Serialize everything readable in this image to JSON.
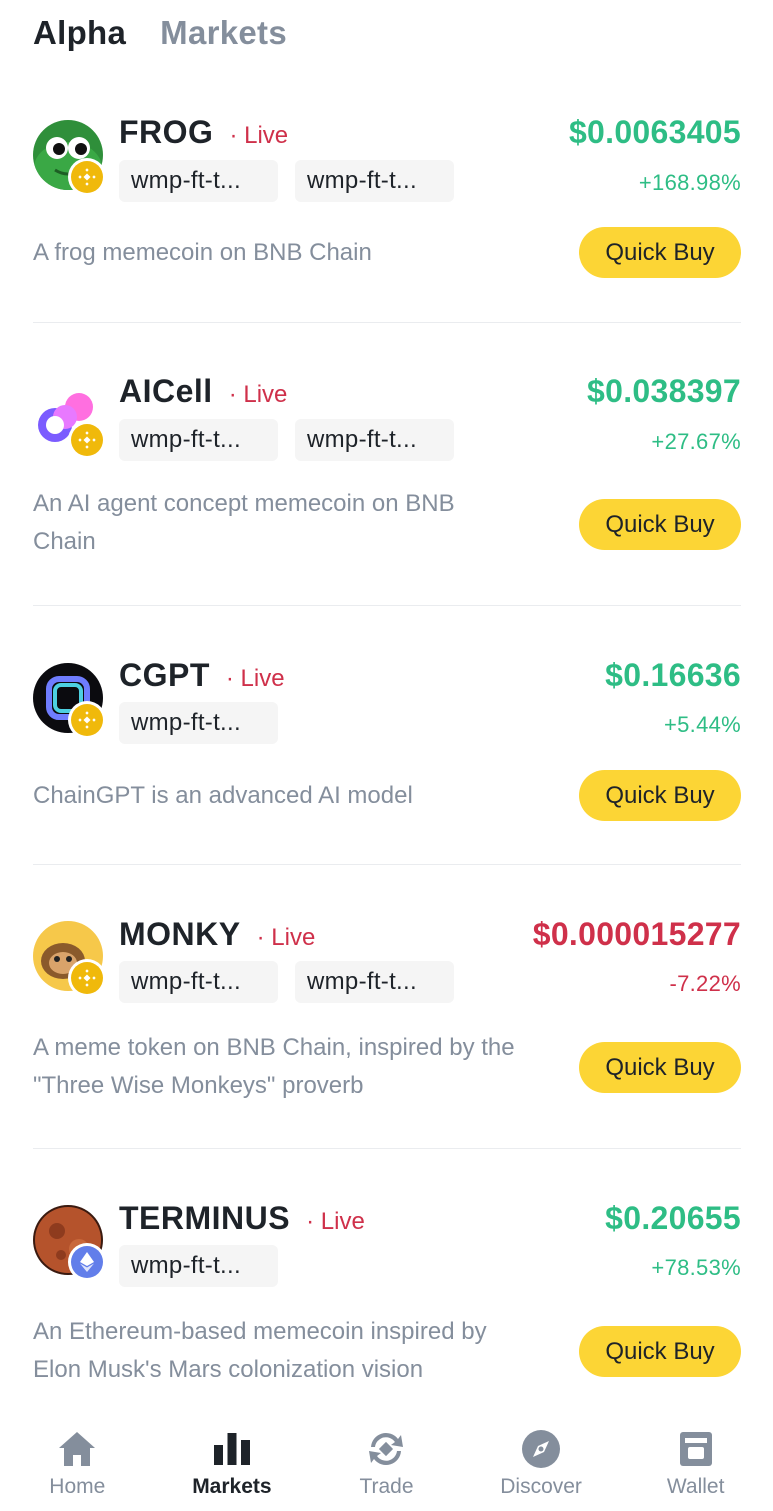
{
  "top_tabs": [
    {
      "label": "Alpha",
      "active": true
    },
    {
      "label": "Markets",
      "active": false
    }
  ],
  "tokens": [
    {
      "symbol": "FROG",
      "status": "· Live",
      "chain": "BNB",
      "tags": [
        "wmp-ft-t...",
        "wmp-ft-t..."
      ],
      "price": "$0.0063405",
      "change": "+168.98%",
      "direction": "up",
      "description": "A frog memecoin on BNB Chain",
      "action": "Quick Buy"
    },
    {
      "symbol": "AICell",
      "status": "· Live",
      "chain": "BNB",
      "tags": [
        "wmp-ft-t...",
        "wmp-ft-t..."
      ],
      "price": "$0.038397",
      "change": "+27.67%",
      "direction": "up",
      "description": "An AI agent concept memecoin on BNB Chain",
      "action": "Quick Buy"
    },
    {
      "symbol": "CGPT",
      "status": "· Live",
      "chain": "BNB",
      "tags": [
        "wmp-ft-t..."
      ],
      "price": "$0.16636",
      "change": "+5.44%",
      "direction": "up",
      "description": "ChainGPT is an advanced AI model",
      "action": "Quick Buy"
    },
    {
      "symbol": "MONKY",
      "status": "· Live",
      "chain": "BNB",
      "tags": [
        "wmp-ft-t...",
        "wmp-ft-t..."
      ],
      "price": "$0.000015277",
      "change": "-7.22%",
      "direction": "down",
      "description": "A meme token on BNB Chain, inspired by the \"Three Wise Monkeys\" proverb",
      "action": "Quick Buy"
    },
    {
      "symbol": "TERMINUS",
      "status": "· Live",
      "chain": "ETH",
      "tags": [
        "wmp-ft-t..."
      ],
      "price": "$0.20655",
      "change": "+78.53%",
      "direction": "up",
      "description": "An Ethereum-based memecoin inspired by Elon Musk's Mars colonization vision",
      "action": "Quick Buy"
    }
  ],
  "bottom_nav": [
    {
      "label": "Home",
      "icon": "home-icon",
      "active": false
    },
    {
      "label": "Markets",
      "icon": "bar-chart-icon",
      "active": true
    },
    {
      "label": "Trade",
      "icon": "trade-icon",
      "active": false
    },
    {
      "label": "Discover",
      "icon": "compass-icon",
      "active": false
    },
    {
      "label": "Wallet",
      "icon": "wallet-icon",
      "active": false
    }
  ],
  "colors": {
    "up": "#2ebd85",
    "down": "#cf304a",
    "live": "#cf304a",
    "accent_button": "#fcd535",
    "bnb_badge": "#f0b90b",
    "eth_badge": "#627eea"
  }
}
